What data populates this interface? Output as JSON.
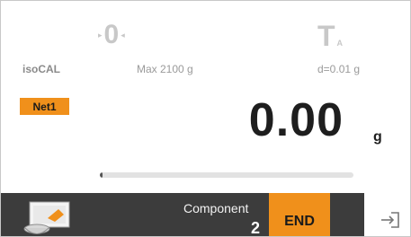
{
  "status": {
    "zero_indicator": "0",
    "zero_arrow_left": "▸",
    "zero_arrow_right": "◂",
    "tare_indicator": "T",
    "tare_subscript": "A"
  },
  "info_line": {
    "calibration": "isoCAL",
    "max_capacity": "Max 2100 g",
    "readability": "d=0.01 g"
  },
  "weighing": {
    "mode_badge": "Net1",
    "value": "0.00",
    "unit": "g",
    "capacity_used_fraction": 0.01
  },
  "bottom_bar": {
    "component_label": "Component",
    "component_number": "2",
    "end_button_label": "END",
    "icons": [
      "component-image-icon",
      "exit-icon"
    ]
  },
  "colors": {
    "accent": "#f0901b",
    "bar_dark": "#3c3c3c",
    "indicator_grey": "#c8c8c8"
  }
}
